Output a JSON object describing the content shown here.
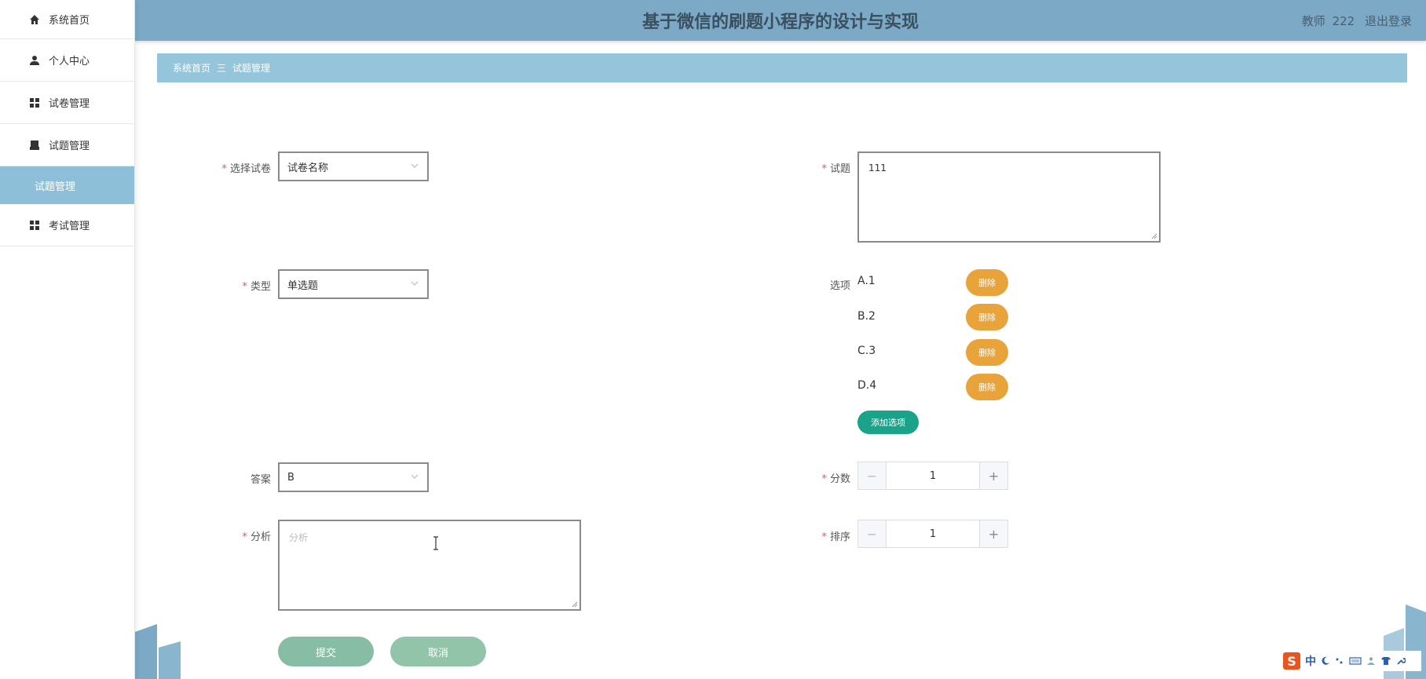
{
  "header": {
    "title": "基于微信的刷题小程序的设计与实现",
    "user_role": "教师",
    "user_name": "222",
    "logout": "退出登录"
  },
  "sidebar": {
    "items": [
      {
        "label": "系统首页",
        "icon": "home-icon"
      },
      {
        "label": "个人中心",
        "icon": "user-icon"
      },
      {
        "label": "试卷管理",
        "icon": "grid-icon"
      },
      {
        "label": "试题管理",
        "icon": "printer-icon"
      },
      {
        "label": "考试管理",
        "icon": "grid-icon"
      }
    ],
    "active_sub": "试题管理"
  },
  "breadcrumb": {
    "home": "系统首页",
    "separator": "三",
    "current": "试题管理"
  },
  "form": {
    "paper_label": "选择试卷",
    "paper_value": "试卷名称",
    "question_label": "试题",
    "question_value": "111",
    "type_label": "类型",
    "type_value": "单选题",
    "options_label": "选项",
    "options": [
      "A.1",
      "B.2",
      "C.3",
      "D.4"
    ],
    "delete_label": "删除",
    "add_option_label": "添加选项",
    "answer_label": "答案",
    "answer_value": "B",
    "score_label": "分数",
    "score_value": "1",
    "analysis_label": "分析",
    "analysis_placeholder": "分析",
    "order_label": "排序",
    "order_value": "1",
    "submit_label": "提交",
    "cancel_label": "取消"
  },
  "ime": {
    "brand": "S",
    "mode": "中"
  },
  "colors": {
    "header_bg": "#7ca9c6",
    "breadcrumb_bg": "#95c5db",
    "sidebar_active_bg": "#8dc0d8",
    "delete_btn": "#e8a33a",
    "add_btn": "#1aa38a",
    "submit_btn": "#87bda5"
  }
}
